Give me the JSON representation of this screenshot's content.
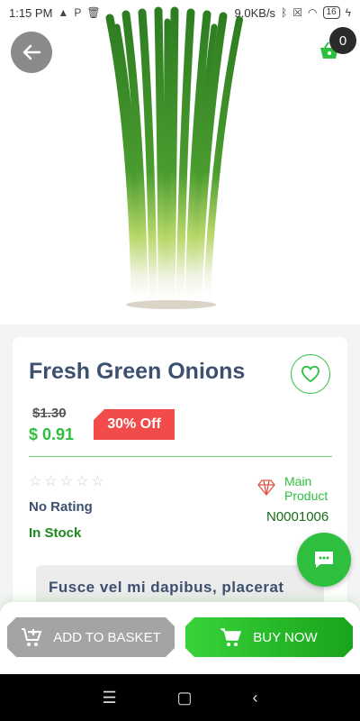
{
  "status_bar": {
    "time": "1:15 PM",
    "net_speed": "9.0KB/s",
    "battery": "16"
  },
  "header": {
    "cart_count": "0"
  },
  "product": {
    "title": "Fresh Green Onions",
    "old_price": "$1.30",
    "price": "$ 0.91",
    "discount": "30% Off",
    "rating_text": "No Rating",
    "stock_text": "In Stock",
    "main_label": "Main Product",
    "code": "N0001006",
    "description_preview": "Fusce vel mi dapibus, placerat"
  },
  "actions": {
    "add_to_basket": "ADD TO BASKET",
    "buy_now": "BUY NOW"
  },
  "colors": {
    "accent": "#2fbf3e",
    "discount": "#f24b4b",
    "title": "#3d5070"
  }
}
